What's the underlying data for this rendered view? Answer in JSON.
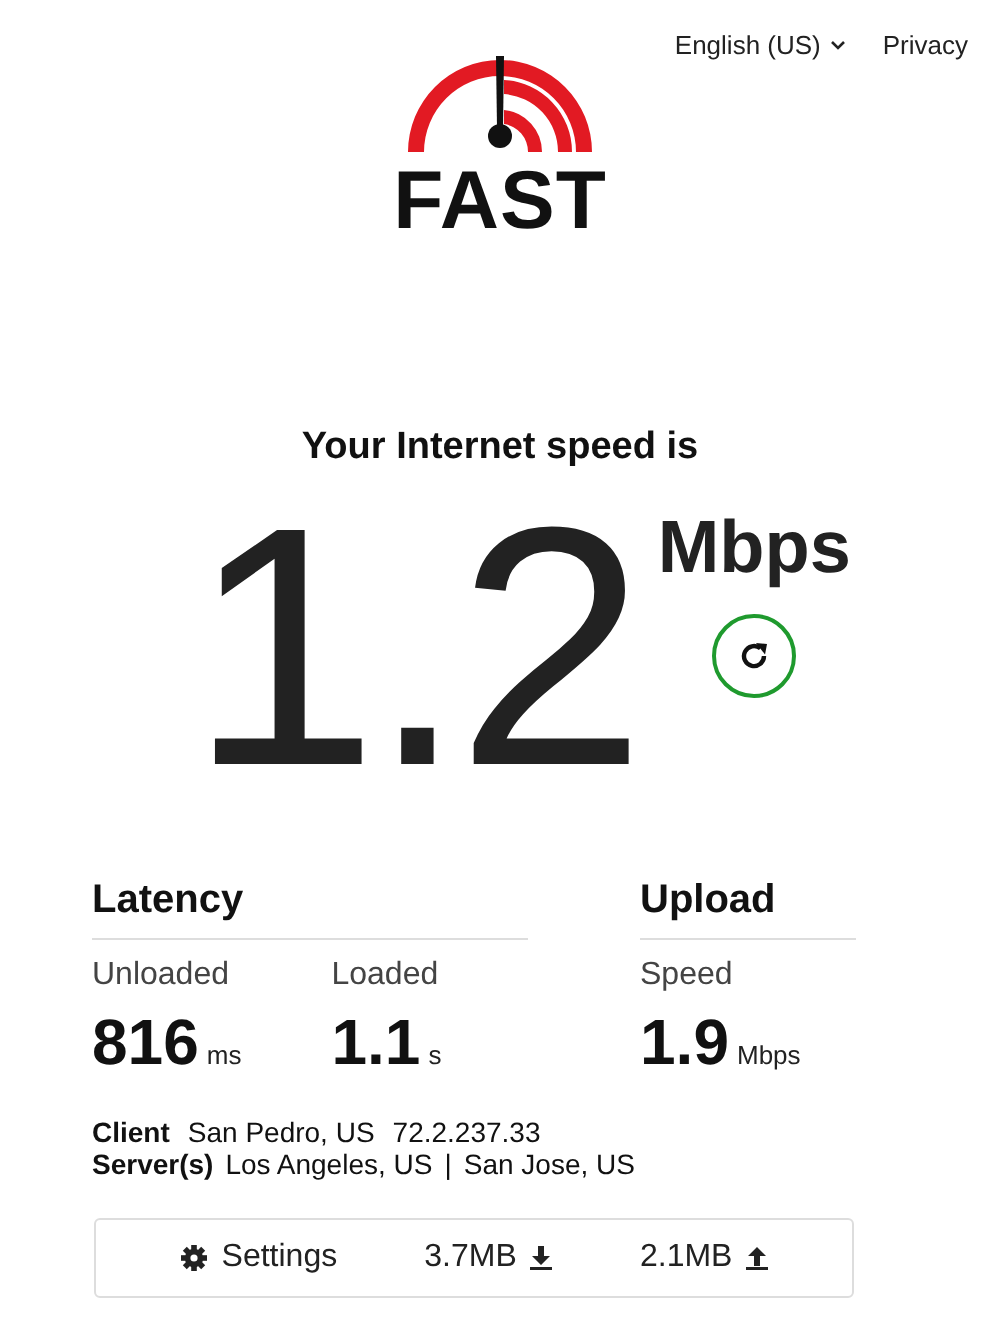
{
  "header": {
    "language": "English (US)",
    "privacy": "Privacy"
  },
  "logo": {
    "text": "FAST"
  },
  "result": {
    "title": "Your Internet speed is",
    "speed": "1.2",
    "unit": "Mbps"
  },
  "latency": {
    "heading": "Latency",
    "metrics": [
      {
        "label": "Unloaded",
        "value": "816",
        "unit": "ms"
      },
      {
        "label": "Loaded",
        "value": "1.1",
        "unit": "s"
      }
    ]
  },
  "upload": {
    "heading": "Upload",
    "metrics": [
      {
        "label": "Speed",
        "value": "1.9",
        "unit": "Mbps"
      }
    ]
  },
  "client": {
    "label": "Client",
    "location": "San Pedro, US",
    "ip": "72.2.237.33"
  },
  "servers": {
    "label": "Server(s)",
    "items": [
      "Los Angeles, US",
      "San Jose, US"
    ],
    "separator": "|"
  },
  "footer": {
    "settings": "Settings",
    "download": "3.7MB",
    "upload": "2.1MB"
  }
}
